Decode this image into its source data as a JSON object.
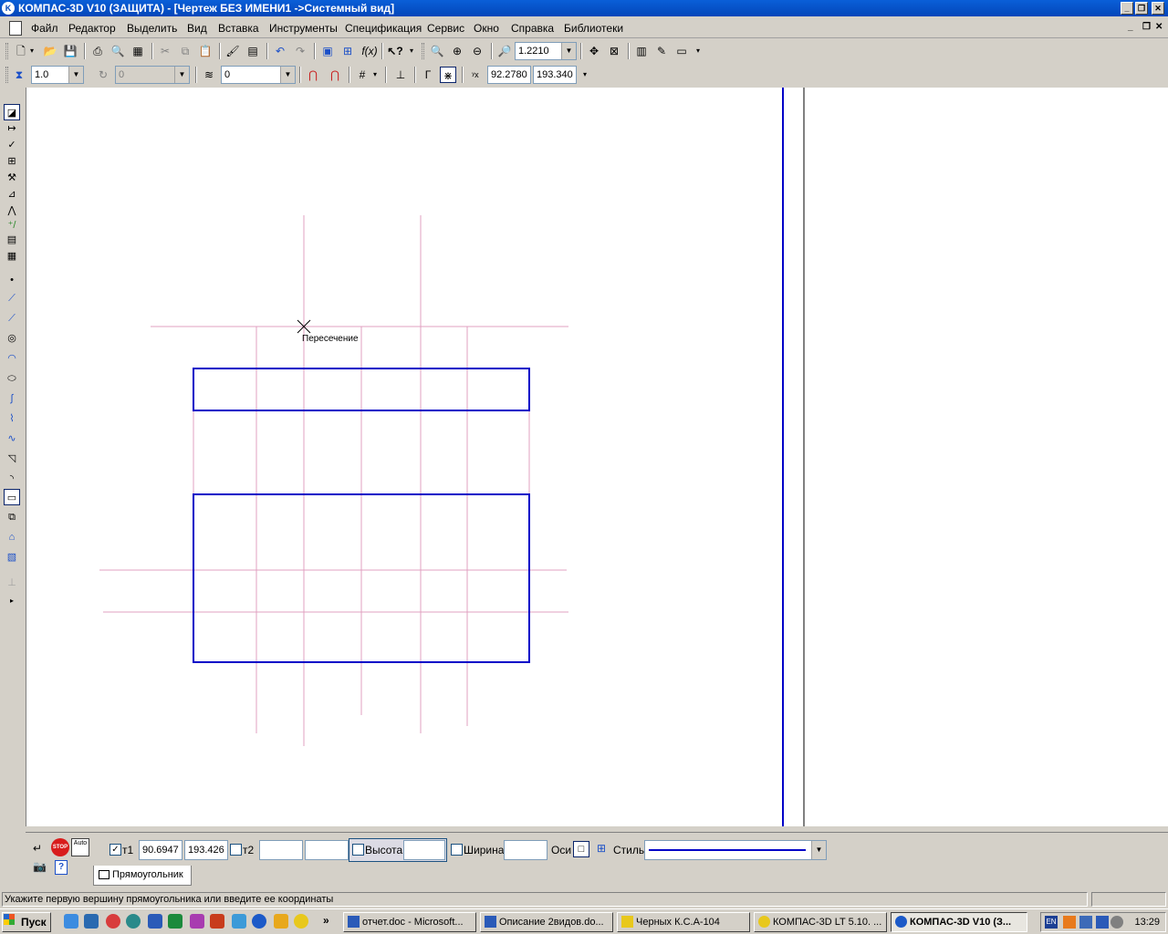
{
  "window": {
    "title": "КОМПАС-3D V10 (ЗАЩИТА) - [Чертеж БЕЗ ИМЕНИ1 ->Системный вид]"
  },
  "menu": [
    {
      "label": "Файл"
    },
    {
      "label": "Редактор"
    },
    {
      "label": "Выделить"
    },
    {
      "label": "Вид"
    },
    {
      "label": "Вставка"
    },
    {
      "label": "Инструменты"
    },
    {
      "label": "Спецификация"
    },
    {
      "label": "Сервис"
    },
    {
      "label": "Окно"
    },
    {
      "label": "Справка"
    },
    {
      "label": "Библиотеки"
    }
  ],
  "toolbar": {
    "zoom_value": "1.2210",
    "step_value": "1.0",
    "angle_value": "0",
    "layer_value": "0",
    "coord_x": "92.2780",
    "coord_y": "193.340"
  },
  "canvas": {
    "snap_label": "Пересечение"
  },
  "props": {
    "t1_label": "т1",
    "t1_x": "90.6947",
    "t1_y": "193.426",
    "t2_label": "т2",
    "t2_x": "",
    "t2_y": "",
    "height_label": "Высота",
    "height_value": "",
    "width_label": "Ширина",
    "width_value": "",
    "axes_label": "Оси",
    "style_label": "Стиль",
    "tab_label": "Прямоугольник",
    "auto_label": "Auto",
    "stop_label": "STOP"
  },
  "status": {
    "text": "Укажите первую вершину прямоугольника или введите ее координаты"
  },
  "taskbar": {
    "start_label": "Пуск",
    "more_label": "»",
    "tasks": [
      {
        "label": "отчет.doc - Microsoft..."
      },
      {
        "label": "Описание 2видов.do..."
      },
      {
        "label": "Черных К.С.А-104"
      },
      {
        "label": "КОМПАС-3D LT 5.10. ..."
      },
      {
        "label": "КОМПАС-3D V10 (З..."
      }
    ],
    "lang": "EN",
    "clock": "13:29"
  },
  "colors": {
    "drawing_line": "#0000c8",
    "aux_line": "#e0a0c0",
    "titlebar": "#0a5fd8"
  }
}
